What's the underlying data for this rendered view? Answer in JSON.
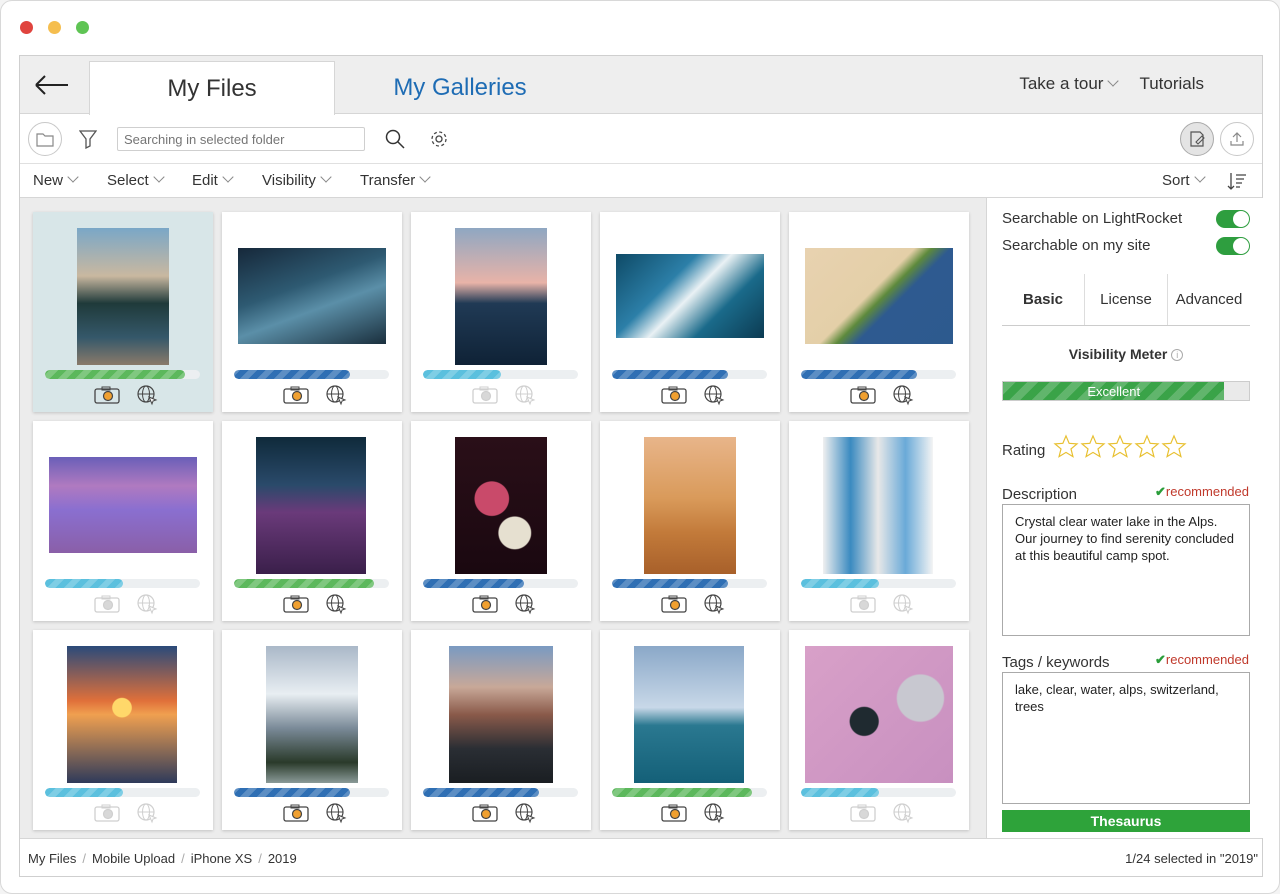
{
  "tabs": {
    "my_files": "My Files",
    "my_galleries": "My Galleries"
  },
  "toplinks": {
    "tour": "Take a tour",
    "tutorials": "Tutorials"
  },
  "search": {
    "placeholder": "Searching in selected folder"
  },
  "menu": {
    "new": "New",
    "select": "Select",
    "edit": "Edit",
    "visibility": "Visibility",
    "transfer": "Transfer",
    "sort": "Sort"
  },
  "colors": {
    "green": "#5cb85c",
    "blue": "#2f6fb4",
    "lightblue": "#5bc0de",
    "accent": "#1e6cb4",
    "ok": "#2ea33a"
  },
  "grid": [
    {
      "selected": true,
      "level": 0.9,
      "color": "green",
      "active": true
    },
    {
      "selected": false,
      "level": 0.75,
      "color": "blue",
      "active": true
    },
    {
      "selected": false,
      "level": 0.5,
      "color": "lightblue",
      "active": false
    },
    {
      "selected": false,
      "level": 0.75,
      "color": "blue",
      "active": true
    },
    {
      "selected": false,
      "level": 0.75,
      "color": "blue",
      "active": true
    },
    {
      "selected": false,
      "level": 0.5,
      "color": "lightblue",
      "active": false
    },
    {
      "selected": false,
      "level": 0.9,
      "color": "green",
      "active": true
    },
    {
      "selected": false,
      "level": 0.65,
      "color": "blue",
      "active": true
    },
    {
      "selected": false,
      "level": 0.75,
      "color": "blue",
      "active": true
    },
    {
      "selected": false,
      "level": 0.5,
      "color": "lightblue",
      "active": false
    },
    {
      "selected": false,
      "level": 0.5,
      "color": "lightblue",
      "active": false
    },
    {
      "selected": false,
      "level": 0.75,
      "color": "blue",
      "active": true
    },
    {
      "selected": false,
      "level": 0.75,
      "color": "blue",
      "active": true
    },
    {
      "selected": false,
      "level": 0.9,
      "color": "green",
      "active": true
    },
    {
      "selected": false,
      "level": 0.5,
      "color": "lightblue",
      "active": false
    }
  ],
  "panel": {
    "searchable_lr": "Searchable on LightRocket",
    "searchable_site": "Searchable on my site",
    "tab_basic": "Basic",
    "tab_license": "License",
    "tab_advanced": "Advanced",
    "visibility_meter": "Visibility Meter",
    "meter_label": "Excellent",
    "meter_level": 0.9,
    "rating_label": "Rating",
    "rating_stars": 0,
    "description_label": "Description",
    "recommended": "recommended",
    "description": "Crystal clear water lake in the Alps. Our journey to find serenity concluded at this beautiful camp spot.",
    "tags_label": "Tags / keywords",
    "tags": "lake, clear, water, alps, switzerland, trees",
    "thesaurus": "Thesaurus"
  },
  "breadcrumb": [
    "My Files",
    "Mobile Upload",
    "iPhone XS",
    "2019"
  ],
  "selection_status": "1/24 selected in \"2019\""
}
